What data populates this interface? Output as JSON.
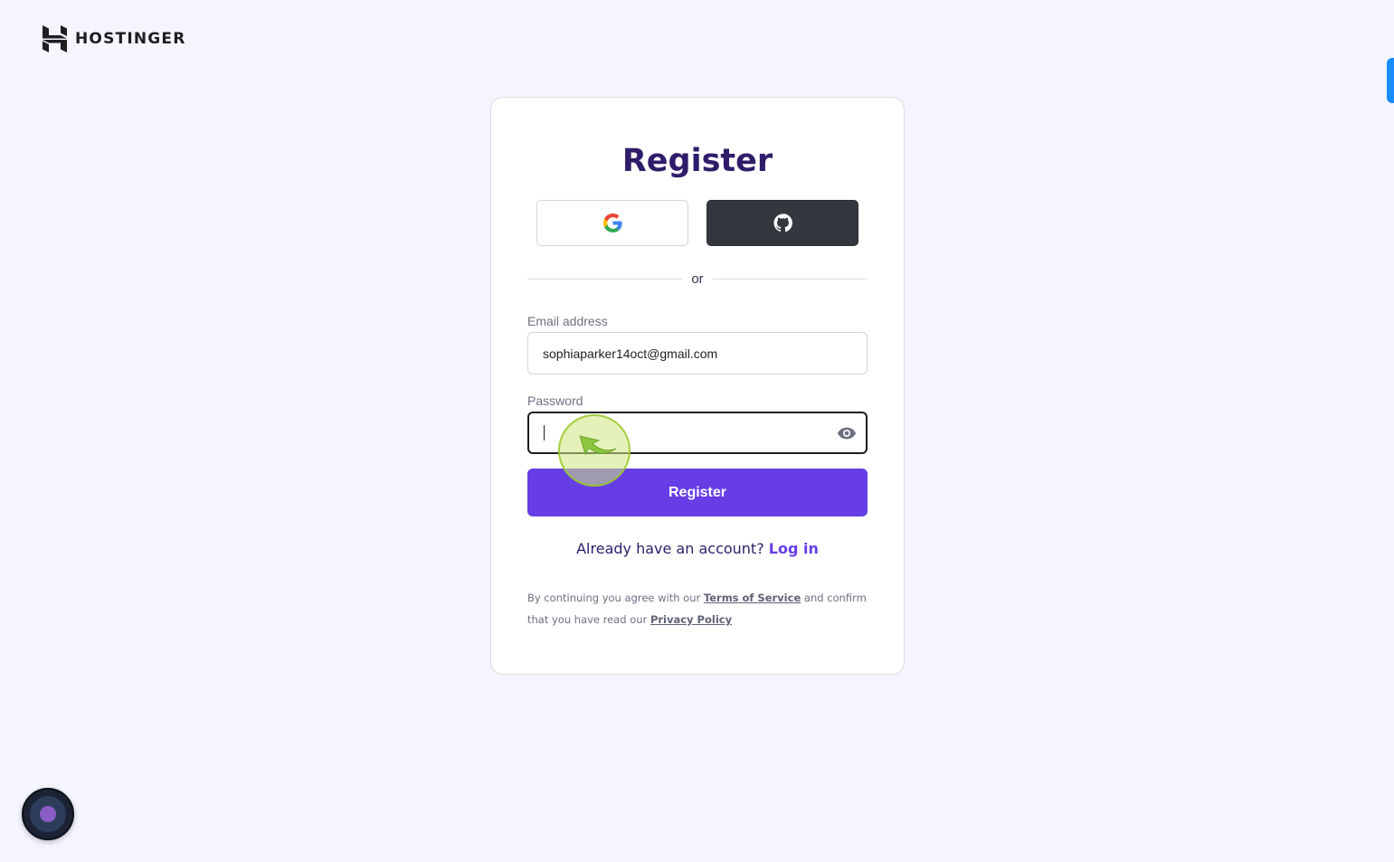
{
  "brand": {
    "name": "HOSTINGER",
    "logo_icon": "hostinger-logo-icon"
  },
  "form": {
    "title": "Register",
    "social": {
      "google_icon": "google-icon",
      "github_icon": "github-icon"
    },
    "divider_text": "or",
    "email": {
      "label": "Email address",
      "value": "sophiaparker14oct@gmail.com"
    },
    "password": {
      "label": "Password",
      "value": "",
      "toggle_icon": "eye-icon"
    },
    "submit_label": "Register",
    "login_prompt": "Already have an account?",
    "login_link": "Log in",
    "legal": {
      "prefix": "By continuing you agree with our",
      "terms_link": "Terms of Service",
      "middle": "and confirm that you have read our",
      "privacy_link": "Privacy Policy"
    }
  },
  "colors": {
    "primary": "#673de6",
    "title": "#2f1c6a",
    "background": "#f4f5fe",
    "github_button": "#33383f"
  }
}
